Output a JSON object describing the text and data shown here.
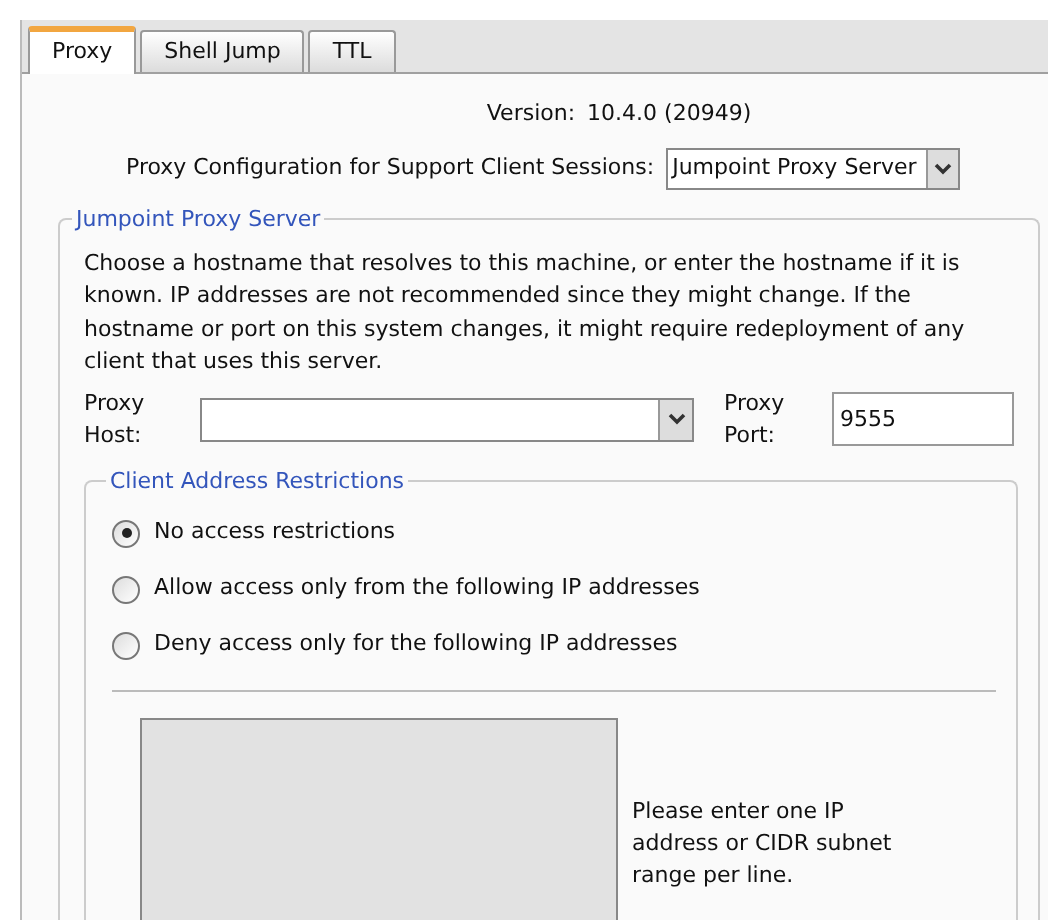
{
  "tabs": [
    {
      "label": "Proxy",
      "selected": true
    },
    {
      "label": "Shell Jump",
      "selected": false
    },
    {
      "label": "TTL",
      "selected": false
    }
  ],
  "version": {
    "label": "Version:",
    "value": "10.4.0 (20949)"
  },
  "proxy_configuration": {
    "label": "Proxy Configuration for Support Client Sessions:",
    "value": "Jumpoint Proxy Server"
  },
  "jumpoint_proxy_server": {
    "title": "Jumpoint Proxy Server",
    "description": [
      "Choose a hostname that resolves to this machine, or enter the hostname if it is",
      "known.  IP addresses are not recommended since they might change.  If the",
      "hostname or port on this system changes, it might require redeployment of any",
      "client that uses this server."
    ],
    "proxy_host": {
      "label": [
        "Proxy",
        "Host:"
      ]
    },
    "proxy_port": {
      "label": [
        "Proxy",
        "Port:"
      ],
      "value": "9555"
    },
    "client_address_restrictions": {
      "title": "Client Address Restrictions",
      "options": [
        {
          "label": "No access restrictions",
          "selected": true
        },
        {
          "label": "Allow access only from the following IP addresses",
          "selected": false
        },
        {
          "label": "Deny access only for the following IP addresses",
          "selected": false
        }
      ],
      "ip_list": {
        "disabled": true
      },
      "help": [
        "Please enter one IP",
        "address or CIDR subnet",
        "range per line."
      ]
    }
  }
}
